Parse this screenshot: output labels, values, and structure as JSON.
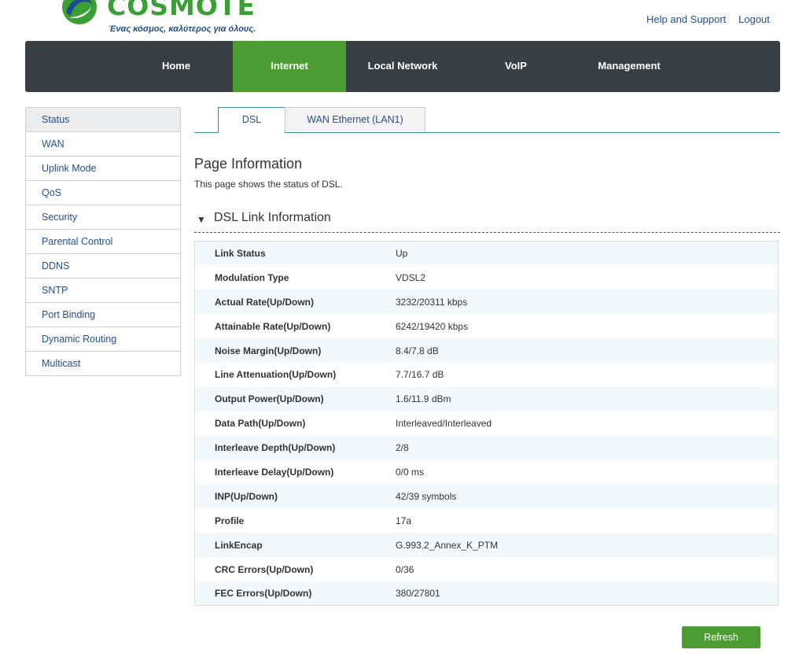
{
  "brand": {
    "name": "COSMOTE",
    "slogan": "Ένας κόσμος, καλύτερος για όλους.",
    "colors": {
      "green": "#3aa035",
      "blue": "#1e4a8f",
      "nav": "#373f44",
      "nav_active": "#4c9c33"
    }
  },
  "top_links": {
    "help": "Help and Support",
    "logout": "Logout"
  },
  "nav": {
    "items": [
      {
        "label": "Home"
      },
      {
        "label": "Internet"
      },
      {
        "label": "Local Network"
      },
      {
        "label": "VoIP"
      },
      {
        "label": "Management"
      }
    ],
    "active": "Internet"
  },
  "sidebar": {
    "items": [
      {
        "label": "Status"
      },
      {
        "label": "WAN"
      },
      {
        "label": "Uplink Mode"
      },
      {
        "label": "QoS"
      },
      {
        "label": "Security"
      },
      {
        "label": "Parental Control"
      },
      {
        "label": "DDNS"
      },
      {
        "label": "SNTP"
      },
      {
        "label": "Port Binding"
      },
      {
        "label": "Dynamic Routing"
      },
      {
        "label": "Multicast"
      }
    ],
    "active": "Status"
  },
  "tabs": {
    "items": [
      {
        "label": "DSL"
      },
      {
        "label": "WAN Ethernet (LAN1)"
      }
    ],
    "active": "DSL"
  },
  "page": {
    "title": "Page Information",
    "description": "This page shows the status of DSL."
  },
  "section": {
    "arrow": "▼",
    "title": "DSL Link Information"
  },
  "dsl_info": [
    {
      "label": "Link Status",
      "value": "Up"
    },
    {
      "label": "Modulation Type",
      "value": "VDSL2"
    },
    {
      "label": "Actual Rate(Up/Down)",
      "value": "3232/20311 kbps"
    },
    {
      "label": "Attainable Rate(Up/Down)",
      "value": "6242/19420 kbps"
    },
    {
      "label": "Noise Margin(Up/Down)",
      "value": "8.4/7.8 dB"
    },
    {
      "label": "Line Attenuation(Up/Down)",
      "value": "7.7/16.7 dB"
    },
    {
      "label": "Output Power(Up/Down)",
      "value": "1.6/11.9 dBm"
    },
    {
      "label": "Data Path(Up/Down)",
      "value": "Interleaved/Interleaved"
    },
    {
      "label": "Interleave Depth(Up/Down)",
      "value": "2/8"
    },
    {
      "label": "Interleave Delay(Up/Down)",
      "value": "0/0 ms"
    },
    {
      "label": "INP(Up/Down)",
      "value": "42/39 symbols"
    },
    {
      "label": "Profile",
      "value": "17a"
    },
    {
      "label": "LinkEncap",
      "value": "G.993.2_Annex_K_PTM"
    },
    {
      "label": "CRC Errors(Up/Down)",
      "value": "0/36"
    },
    {
      "label": "FEC Errors(Up/Down)",
      "value": "380/27801"
    }
  ],
  "buttons": {
    "refresh": "Refresh"
  }
}
